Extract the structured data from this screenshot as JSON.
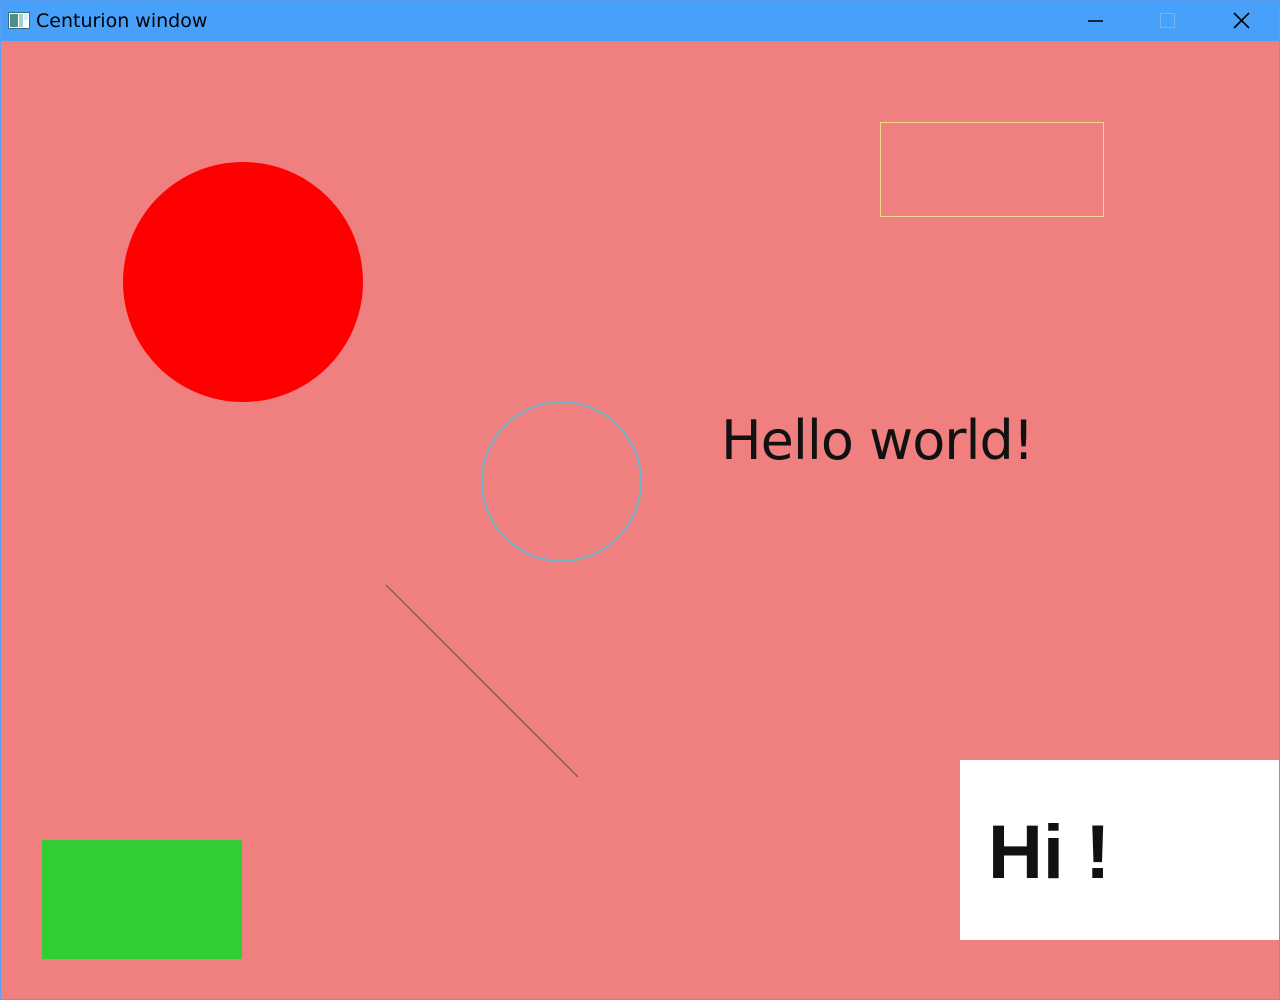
{
  "window": {
    "title": "Centurion window",
    "titlebar_color": "#47a1fb",
    "background_color": "#f08080",
    "app_icon": "window-app-icon",
    "controls": {
      "minimize_icon": "minimize-icon",
      "maximize_icon": "maximize-icon",
      "close_icon": "close-icon"
    }
  },
  "canvas": {
    "texts": {
      "hello": "Hello world!",
      "hi": "Hi !"
    },
    "colors": {
      "filled_circle": "#ff0000",
      "outline_rect": "#f5d98a",
      "outline_circle": "#6fb6c8",
      "line": "#556b2f",
      "green_rect": "#32cd32",
      "text_box_bg": "#ffffff",
      "text": "#111111"
    }
  }
}
